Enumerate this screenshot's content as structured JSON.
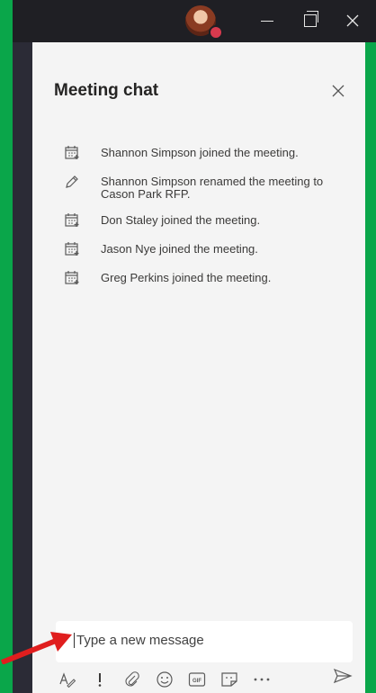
{
  "panel": {
    "title": "Meeting chat"
  },
  "events": [
    {
      "icon": "calendar-icon",
      "text": "Shannon Simpson joined the meeting."
    },
    {
      "icon": "pencil-icon",
      "text": "Shannon Simpson renamed the meeting to Cason Park RFP."
    },
    {
      "icon": "calendar-icon",
      "text": "Don Staley joined the meeting."
    },
    {
      "icon": "calendar-icon",
      "text": "Jason Nye joined the meeting."
    },
    {
      "icon": "calendar-icon",
      "text": "Greg Perkins joined the meeting."
    }
  ],
  "compose": {
    "placeholder": "Type a new message"
  },
  "toolbar": {
    "icons": [
      "format-icon",
      "important-icon",
      "attach-icon",
      "emoji-icon",
      "gif-icon",
      "sticker-icon",
      "more-icon",
      "send-icon"
    ],
    "gif_label": "GIF"
  },
  "colors": {
    "frame": "#0aa64a",
    "titlebar": "#1f1f24",
    "panel": "#f4f4f4",
    "arrow": "#e01e1e"
  }
}
